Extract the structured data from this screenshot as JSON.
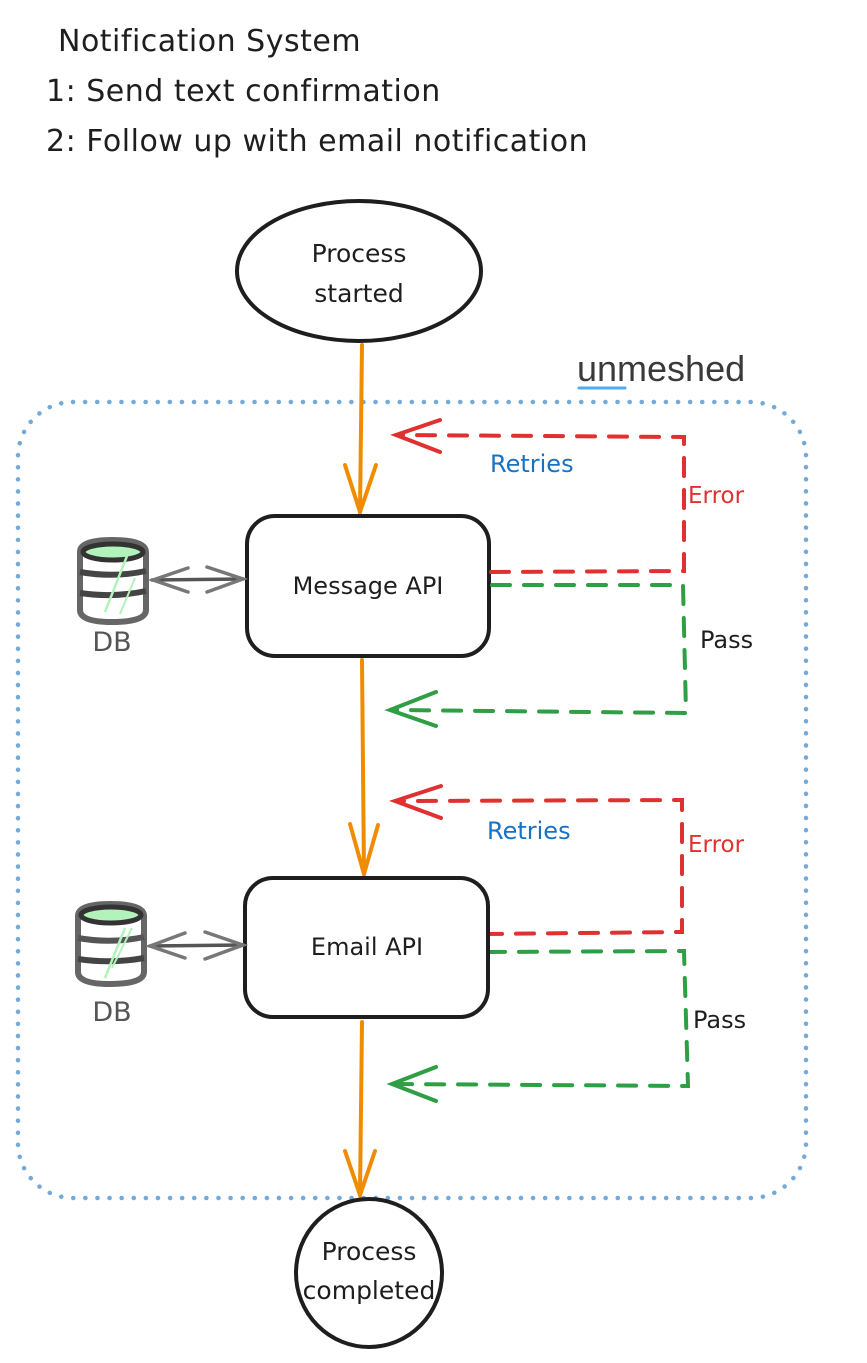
{
  "header": {
    "title": "Notification System",
    "steps": [
      "1: Send text confirmation",
      "2: Follow up with email notification"
    ]
  },
  "brand": {
    "name": "unmeshed",
    "underline_color": "#4dabf7"
  },
  "nodes": {
    "start": {
      "line1": "Process",
      "line2": "started"
    },
    "message_api": {
      "label": "Message API"
    },
    "email_api": {
      "label": "Email API"
    },
    "end": {
      "line1": "Process",
      "line2": "completed"
    }
  },
  "databases": [
    {
      "label": "DB",
      "icon": "database-icon",
      "connects_to": "Message API"
    },
    {
      "label": "DB",
      "icon": "database-icon",
      "connects_to": "Email API"
    }
  ],
  "loops": [
    {
      "for": "Message API",
      "retry_label": "Retries",
      "error_label": "Error",
      "pass_label": "Pass"
    },
    {
      "for": "Email API",
      "retry_label": "Retries",
      "error_label": "Error",
      "pass_label": "Pass"
    }
  ],
  "colors": {
    "flow": "#f08c00",
    "error": "#e03131",
    "pass": "#2f9e44",
    "retries_text": "#1971c2",
    "container": "#74a9d8",
    "stroke": "#1e1e1e",
    "db_stroke": "#666666",
    "db_fill": "#b2f2bb"
  }
}
